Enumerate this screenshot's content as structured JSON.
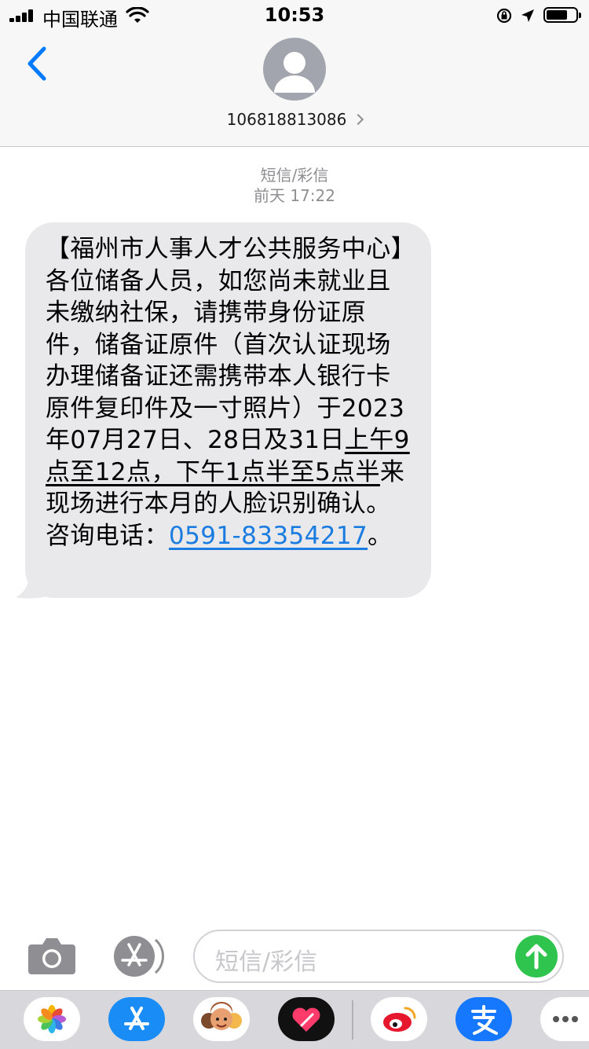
{
  "status_bar": {
    "carrier": "中国联通",
    "time": "10:53"
  },
  "header": {
    "contact_number": "106818813086"
  },
  "message_meta": {
    "type": "短信/彩信",
    "timestamp": "前天 17:22"
  },
  "message": {
    "text_before": "【福州市人事人才公共服务中心】各位储备人员，如您尚未就业且未缴纳社保，请携带身份证原件，储备证原件（首次认证现场办理储备证还需携带本人银行卡原件复印件及一寸照片）于2023年07月27日、28日及31日",
    "text_underlined": "上午9点至12点，下午1点半至5点半",
    "text_after": "来现场进行本月的人脸识别确认。咨询电话：",
    "phone": "0591-83354217",
    "text_end": "。"
  },
  "input_bar": {
    "placeholder": "短信/彩信"
  },
  "icons": [
    "camera-icon",
    "app-store-icon",
    "send-arrow-icon"
  ],
  "app_drawer": {
    "apps": [
      "photos-icon",
      "app-store-icon",
      "memoji-icon",
      "digital-touch-icon",
      "weibo-icon",
      "alipay-icon",
      "more-icon"
    ]
  },
  "colors": {
    "bubble": "#e9e9eb",
    "link": "#1a7ce0",
    "ios_blue": "#007aff",
    "send_green": "#2fc44e"
  }
}
